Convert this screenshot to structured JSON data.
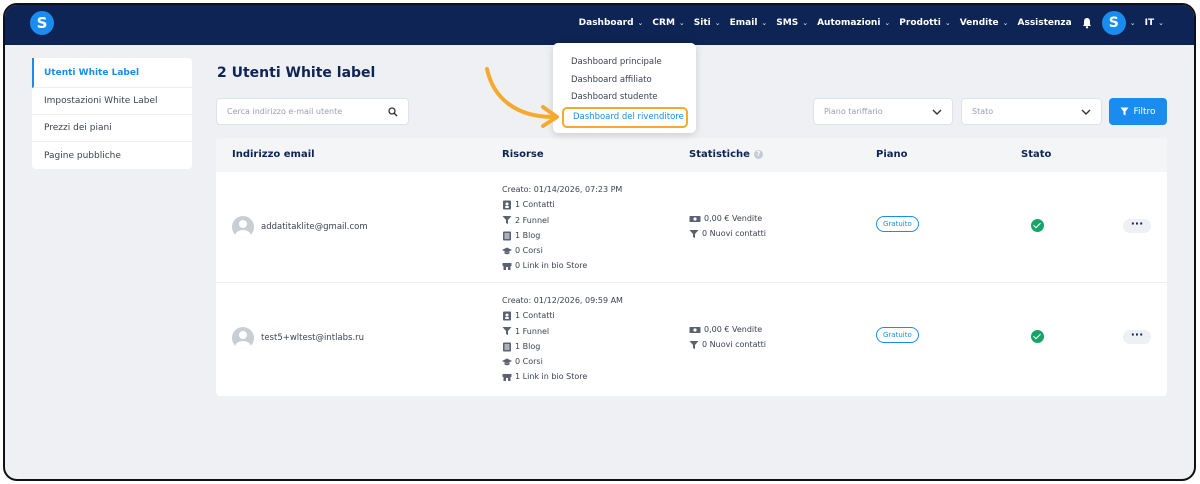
{
  "header": {
    "logo_letter": "S",
    "nav": [
      {
        "label": "Dashboard"
      },
      {
        "label": "CRM"
      },
      {
        "label": "Siti"
      },
      {
        "label": "Email"
      },
      {
        "label": "SMS"
      },
      {
        "label": "Automazioni"
      },
      {
        "label": "Prodotti"
      },
      {
        "label": "Vendite"
      },
      {
        "label": "Assistenza"
      }
    ],
    "avatar_letter": "S",
    "language": "IT"
  },
  "dashboard_menu": {
    "items": [
      "Dashboard principale",
      "Dashboard affiliato",
      "Dashboard studente",
      "Dashboard del rivenditore"
    ]
  },
  "sidebar": {
    "items": [
      {
        "label": "Utenti White Label"
      },
      {
        "label": "Impostazioni White Label"
      },
      {
        "label": "Prezzi dei piani"
      },
      {
        "label": "Pagine pubbliche"
      }
    ]
  },
  "main": {
    "title": "2 Utenti White label",
    "search_placeholder": "Cerca indirizzo e-mail utente",
    "plan_select": "Piano tariffario",
    "status_select": "Stato",
    "filter_label": "Filtro"
  },
  "table": {
    "headers": {
      "email": "Indirizzo email",
      "resources": "Risorse",
      "stats": "Statistiche",
      "plan": "Piano",
      "status": "Stato"
    },
    "rows": [
      {
        "email": "addatitaklite@gmail.com",
        "created": "Creato: 01/14/2026, 07:23 PM",
        "contacts": "1 Contatti",
        "funnels": "2 Funnel",
        "blogs": "1 Blog",
        "courses": "0 Corsi",
        "linkinbio": "0 Link in bio Store",
        "sales": "0,00 € Vendite",
        "new_contacts": "0 Nuovi contatti",
        "plan": "Gratuito"
      },
      {
        "email": "test5+wltest@intlabs.ru",
        "created": "Creato: 01/12/2026, 09:59 AM",
        "contacts": "1 Contatti",
        "funnels": "1 Funnel",
        "blogs": "1 Blog",
        "courses": "0 Corsi",
        "linkinbio": "1 Link in bio Store",
        "sales": "0,00 € Vendite",
        "new_contacts": "0 Nuovi contatti",
        "plan": "Gratuito"
      }
    ]
  },
  "colors": {
    "header_bg": "#0d2454",
    "accent": "#1a8cf0",
    "highlight": "#f4aa2e",
    "success": "#18a36b"
  },
  "icons": [
    "search-icon",
    "filter-icon",
    "bell-icon",
    "chevron-down-icon",
    "contacts-icon",
    "funnel-icon",
    "blog-icon",
    "course-icon",
    "store-icon",
    "money-icon",
    "more-icon",
    "check-icon",
    "info-icon"
  ]
}
